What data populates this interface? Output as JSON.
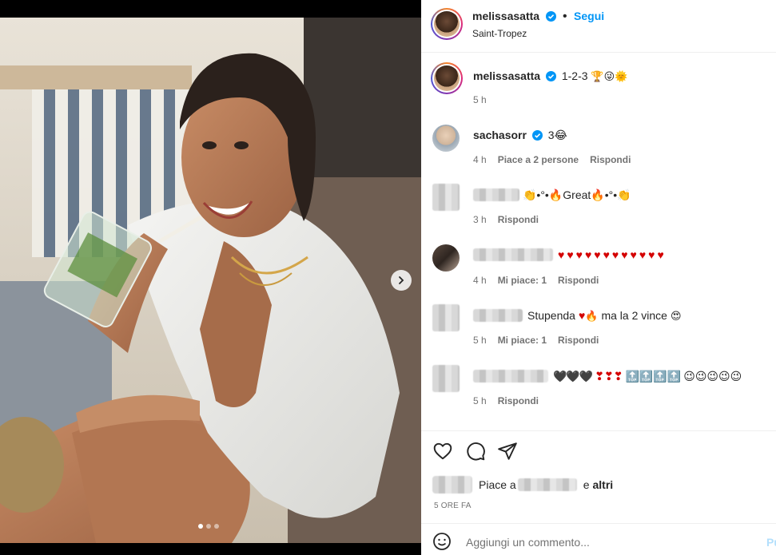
{
  "post": {
    "author": "melissasatta",
    "follow_label": "Segui",
    "location": "Saint-Tropez",
    "separator": "•",
    "caption_text": "1-2-3",
    "caption_time": "5 h",
    "carousel_position": 1,
    "carousel_total": 3
  },
  "comments": [
    {
      "user": "sachasorr",
      "text": "3😂",
      "time": "4 h",
      "likes": "Piace a 2 persone",
      "reply": "Rispondi"
    },
    {
      "user": "",
      "text": "👏•°•🔥Great🔥•°•👏",
      "time": "3 h",
      "likes": "",
      "reply": "Rispondi"
    },
    {
      "user": "",
      "text": "",
      "time": "4 h",
      "likes": "Mi piace: 1",
      "reply": "Rispondi",
      "hearts": 12
    },
    {
      "user": "",
      "text_before": "Stupenda",
      "text_after": "ma la 2 vince",
      "time": "5 h",
      "likes": "Mi piace: 1",
      "reply": "Rispondi"
    },
    {
      "user": "",
      "text": "",
      "time": "5 h",
      "likes": "",
      "reply": "Rispondi"
    }
  ],
  "footer": {
    "likes_prefix": "Piace a",
    "likes_conj": "e",
    "likes_others": "altri",
    "time_ago": "5 ORE FA",
    "comment_placeholder": "Aggiungi un commento...",
    "post_label": "Pu"
  },
  "icons": {
    "like": "heart-icon",
    "comment": "comment-icon",
    "share": "share-icon",
    "emoji": "emoji-icon",
    "next": "chevron-right-icon",
    "verified": "verified-badge-icon"
  },
  "colors": {
    "link_blue": "#0095f6",
    "verified_blue": "#0095f6",
    "muted": "#737373",
    "heart_red": "#d40000"
  }
}
